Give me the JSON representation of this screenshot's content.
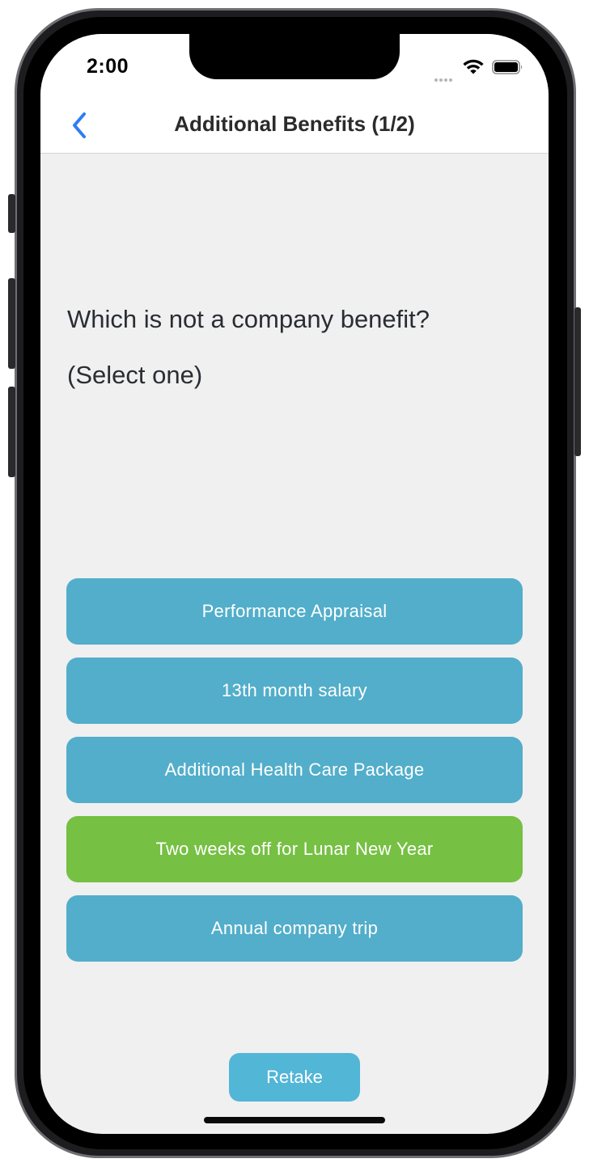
{
  "status_bar": {
    "time": "2:00"
  },
  "nav": {
    "title": "Additional Benefits (1/2)",
    "back_icon": "chevron-left-icon",
    "accent_color": "#2f7df6"
  },
  "quiz": {
    "question": "Which is not a company benefit?",
    "instruction": "(Select one)",
    "options": [
      {
        "label": "Performance Appraisal",
        "selected": false
      },
      {
        "label": "13th month salary",
        "selected": false
      },
      {
        "label": "Additional Health Care Package",
        "selected": false
      },
      {
        "label": "Two weeks off for Lunar New Year",
        "selected": true
      },
      {
        "label": "Annual company trip",
        "selected": false
      }
    ],
    "option_color": "#52aeca",
    "selected_color": "#76c043"
  },
  "footer": {
    "retake_label": "Retake"
  }
}
